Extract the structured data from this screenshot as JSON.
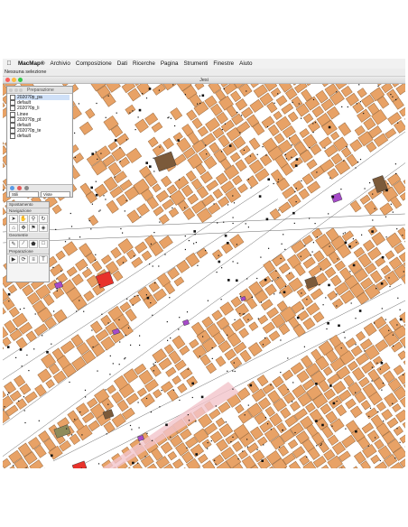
{
  "menubar": {
    "app_name": "MacMap®",
    "items": [
      "Archivio",
      "Composizione",
      "Dati",
      "Ricerche",
      "Pagina",
      "Strumenti",
      "Finestre",
      "Aiuto"
    ]
  },
  "status": {
    "text": "Nessuna selezione"
  },
  "window": {
    "title": "Jesi"
  },
  "layers_palette": {
    "title": "Preparazione",
    "layers": [
      "2020?0p_pa",
      "default",
      "2020?0p_li",
      "Linee",
      "2020?0p_pt",
      "default",
      "2020?0p_te",
      "default"
    ],
    "select_left": "Stili",
    "select_right": "Viste"
  },
  "tool_palette": {
    "groups": [
      "Spostamento",
      "Navigazione",
      "Geometrie",
      "Preparazione"
    ]
  },
  "colors": {
    "building": "#E8A266",
    "building_stroke": "#9a6a3e",
    "road_stroke": "#444444",
    "special_red": "#E8322B",
    "special_purple": "#A64AC9",
    "special_brown": "#7B5A3A",
    "special_olive": "#8E8B5A",
    "pink_road": "#F2C4CB"
  }
}
